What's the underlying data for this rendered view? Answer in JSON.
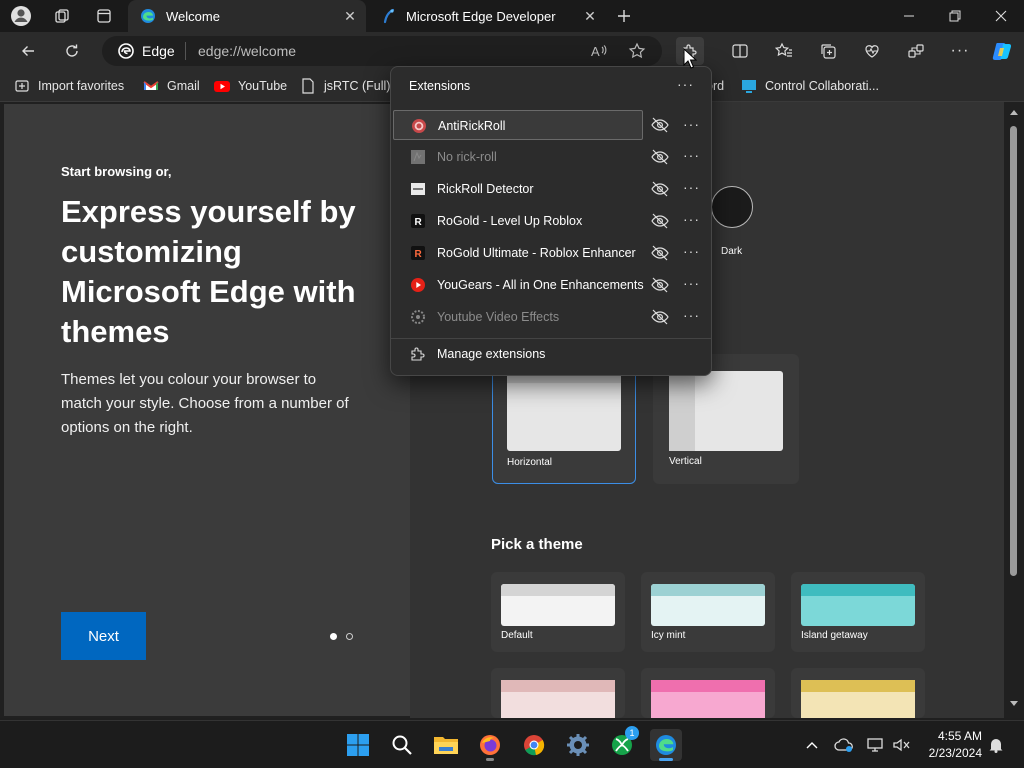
{
  "tabs": [
    {
      "label": "Welcome",
      "active": true
    },
    {
      "label": "Microsoft Edge Developer",
      "active": false
    }
  ],
  "address": {
    "brand": "Edge",
    "url": "edge://welcome"
  },
  "favorites": [
    {
      "label": "Import favorites",
      "icon": "import-icon"
    },
    {
      "label": "Gmail",
      "icon": "gmail-icon"
    },
    {
      "label": "YouTube",
      "icon": "youtube-icon"
    },
    {
      "label": "jsRTC (Full)",
      "icon": "page-icon"
    },
    {
      "label": "ord",
      "icon": "page-icon"
    },
    {
      "label": "Control Collaborati...",
      "icon": "monitor-icon"
    }
  ],
  "welcome": {
    "kicker": "Start browsing or,",
    "headline": "Express yourself by customizing Microsoft Edge with themes",
    "body": "Themes let you colour your browser to match your style. Choose from a number of options on the right.",
    "next_label": "Next"
  },
  "appearance": {
    "dark_label": "Dark",
    "layout_options": [
      "Horizontal",
      "Vertical"
    ],
    "pick_theme_heading": "Pick a theme",
    "themes": [
      "Default",
      "Icy mint",
      "Island getaway"
    ]
  },
  "extensions": {
    "title": "Extensions",
    "items": [
      {
        "name": "AntiRickRoll",
        "enabled": true,
        "highlighted": true
      },
      {
        "name": "No rick-roll",
        "enabled": false
      },
      {
        "name": "RickRoll Detector",
        "enabled": true
      },
      {
        "name": "RoGold - Level Up Roblox",
        "enabled": true
      },
      {
        "name": "RoGold Ultimate - Roblox Enhancer",
        "enabled": true
      },
      {
        "name": "YouGears - All in One Enhancements",
        "enabled": true
      },
      {
        "name": "Youtube Video Effects",
        "enabled": false
      }
    ],
    "manage_label": "Manage extensions"
  },
  "taskbar": {
    "time": "4:55 AM",
    "date": "2/23/2024",
    "xbox_badge": "1"
  },
  "colors": {
    "accent": "#0f6cbd",
    "next_button": "#0067c0",
    "selected_border": "#3c8ee6"
  }
}
